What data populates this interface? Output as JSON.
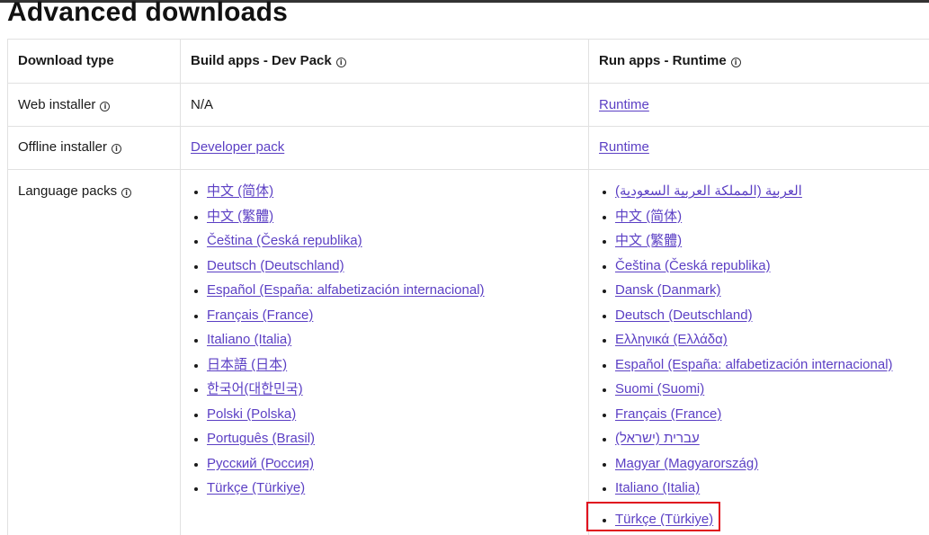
{
  "page": {
    "title": "Advanced downloads"
  },
  "table": {
    "headers": {
      "download_type": "Download type",
      "build_apps": "Build apps - Dev Pack",
      "run_apps": "Run apps - Runtime"
    },
    "info_icon_glyph": "i",
    "rows": {
      "web_installer": {
        "label": "Web installer",
        "dev_pack": "N/A",
        "runtime": "Runtime"
      },
      "offline_installer": {
        "label": "Offline installer",
        "dev_pack": "Developer pack",
        "runtime": "Runtime"
      },
      "language_packs": {
        "label": "Language packs"
      }
    },
    "dev_pack_languages": [
      "中文 (简体)",
      "中文 (繁體)",
      "Čeština (Česká republika)",
      "Deutsch (Deutschland)",
      "Español (España: alfabetización internacional)",
      "Français (France)",
      "Italiano (Italia)",
      "日本語 (日本)",
      "한국어(대한민국)",
      "Polski (Polska)",
      "Português (Brasil)",
      "Русский (Россия)",
      "Türkçe (Türkiye)"
    ],
    "runtime_languages": [
      "العربية (المملكة العربية السعودية)",
      "中文 (简体)",
      "中文 (繁體)",
      "Čeština (Česká republika)",
      "Dansk (Danmark)",
      "Deutsch (Deutschland)",
      "Ελληνικά (Ελλάδα)",
      "Español (España: alfabetización internacional)",
      "Suomi (Suomi)",
      "Français (France)",
      "עברית (ישראל)",
      "Magyar (Magyarország)",
      "Italiano (Italia)",
      "Türkçe (Türkiye)"
    ]
  },
  "colors": {
    "link": "#5b3fc4",
    "highlight": "#e0101e",
    "border": "#e1e1e1"
  }
}
